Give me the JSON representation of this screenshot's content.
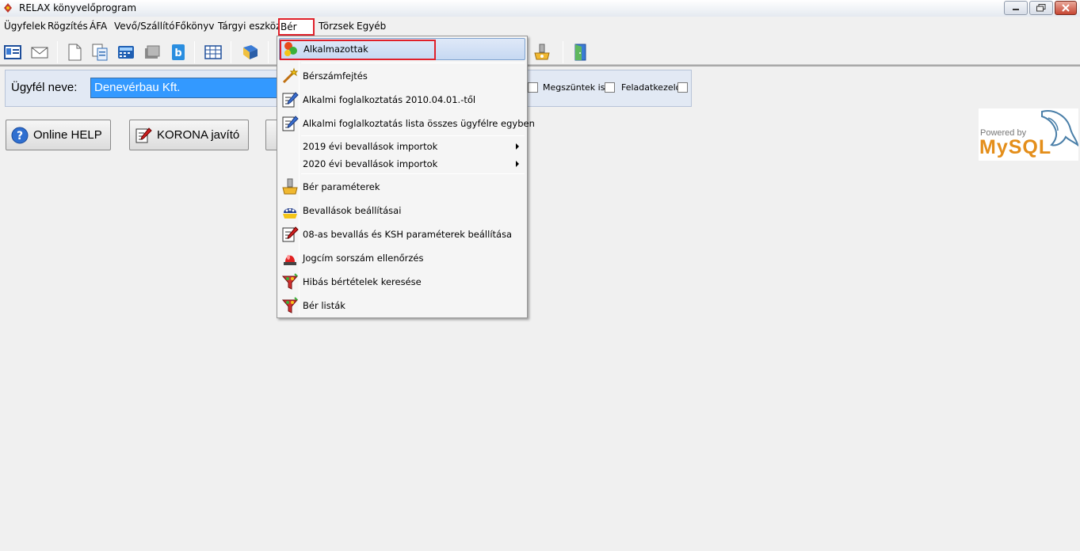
{
  "window": {
    "title": "RELAX könyvelőprogram"
  },
  "menubar": {
    "items": [
      "Ügyfelek",
      "Rögzítés",
      "ÁFA",
      "Vevő/Szállító",
      "Főkönyv",
      "Tárgyi eszköz",
      "Bér",
      "Törzsek",
      "Egyéb"
    ],
    "active": "Bér"
  },
  "client": {
    "label": "Ügyfél neve:",
    "value": "Denevérbau Kft.",
    "checkbox1_label": "Megszüntek is",
    "checkbox2_label": "Feladatkezelő"
  },
  "buttons": {
    "help": "Online HELP",
    "korona": "KORONA javító"
  },
  "mysql": {
    "powered": "Powered by",
    "brand": "MySQL"
  },
  "dropdown": {
    "items": [
      {
        "label": "Alkalmazottak",
        "icon": "employees-icon"
      },
      {
        "label": "Bérszámfejtés",
        "icon": "magic-wand-icon"
      },
      {
        "label": "Alkalmi foglalkoztatás 2010.04.01.-től",
        "icon": "edit-form-icon"
      },
      {
        "label": "Alkalmi foglalkoztatás lista összes ügyfélre egyben",
        "icon": "edit-form-icon"
      },
      {
        "label": "2019 évi bevallások importok",
        "submenu": true
      },
      {
        "label": "2020 évi bevallások importok",
        "submenu": true
      },
      {
        "label": "Bér paraméterek",
        "icon": "parameters-icon"
      },
      {
        "label": "Bevallások beállításai",
        "icon": "tax-return-settings-icon"
      },
      {
        "label": "08-as bevallás és KSH paraméterek beállítása",
        "icon": "edit-form-icon"
      },
      {
        "label": "Jogcím sorszám ellenőrzés",
        "icon": "alarm-light-icon"
      },
      {
        "label": "Hibás bértételek keresése",
        "icon": "filter-icon"
      },
      {
        "label": "Bér listák",
        "icon": "filter-icon"
      }
    ]
  }
}
